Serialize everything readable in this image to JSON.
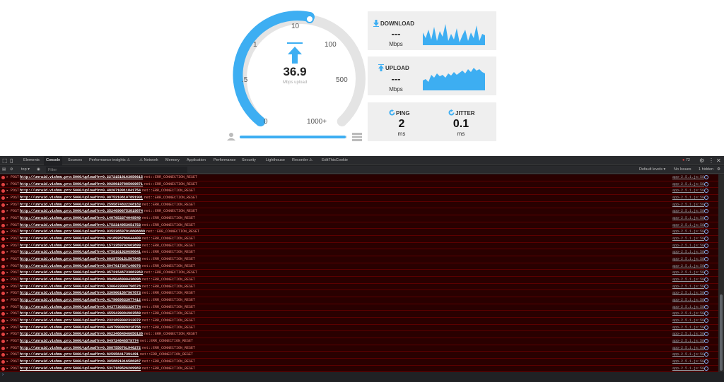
{
  "gauge": {
    "labels": [
      "0",
      ".5",
      "1",
      "10",
      "100",
      "500",
      "1000+"
    ],
    "value": "36.9",
    "unit": "Mbps upload",
    "progress": 0.99
  },
  "download": {
    "title": "DOWNLOAD",
    "value": "---",
    "unit": "Mbps"
  },
  "upload": {
    "title": "UPLOAD",
    "value": "---",
    "unit": "Mbps"
  },
  "ping": {
    "title": "PING",
    "value": "2",
    "unit": "ms"
  },
  "jitter": {
    "title": "JITTER",
    "value": "0.1",
    "unit": "ms"
  },
  "colors": {
    "accent": "#3daef2",
    "error_bg": "#290000",
    "error_text": "#f28b82"
  },
  "devtools": {
    "tabs": [
      "Elements",
      "Console",
      "Sources",
      "Performance insights ⚠",
      "⚠ Network",
      "Memory",
      "Application",
      "Performance",
      "Security",
      "Lighthouse",
      "Recorder ⚠",
      "EditThisCookie"
    ],
    "active_tab": "Console",
    "error_count": "72",
    "context": "top ▾",
    "filter_placeholder": "Filter",
    "levels": "Default levels ▾",
    "issues": "No Issues",
    "hidden": "1 hidden"
  },
  "log": {
    "method": "▸ POST",
    "url_prefix": "http://unraid.vishnu.pro:5000/upload?n=",
    "error": "net::ERR_CONNECTION_RESET",
    "source": "app-2.5.1.js:58",
    "entries": [
      "0.22721518163856615",
      "0.09286197885609871",
      "0.4820710911841754",
      "0.08752106107891901",
      "0.2595874832208183",
      "0.35246906753819874",
      "0.1407653374049540",
      "0.1752314953651753",
      "0.035236597918806889",
      "0.2618926786644409",
      "0.1573359702663699",
      "0.4750101920696641",
      "0.6839750151507645",
      "0.5047617367148076",
      "0.05721546733663363",
      "0.9949046900436098",
      "0.5300433000796578",
      "0.3309001567907873",
      "0.4179669633077412",
      "0.6437730352326774",
      "0.4559439094963569",
      "0.2321693002312072",
      "0.4497990929218758",
      "0.06234684946050138",
      "0.849724846579774",
      "0.5887550761946272",
      "0.825956417391491",
      "0.3058821016586287",
      "0.5317169526269983"
    ]
  }
}
